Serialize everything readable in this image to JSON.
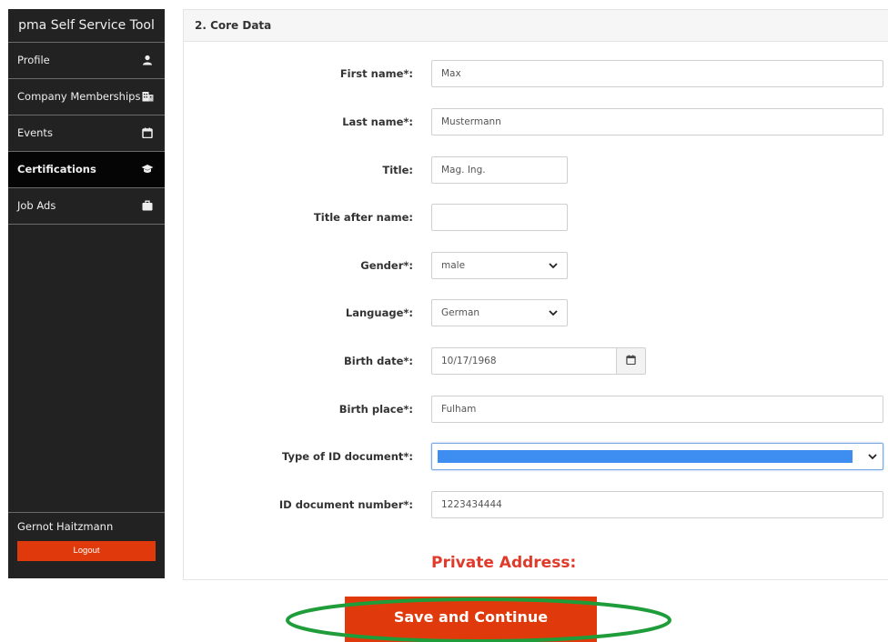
{
  "sidebar": {
    "title": "pma Self Service Tool",
    "items": [
      {
        "label": "Profile",
        "icon": "user-icon",
        "active": false
      },
      {
        "label": "Company Memberships",
        "icon": "building-icon",
        "active": false
      },
      {
        "label": "Events",
        "icon": "calendar-icon",
        "active": false
      },
      {
        "label": "Certifications",
        "icon": "graduation-cap-icon",
        "active": true
      },
      {
        "label": "Job Ads",
        "icon": "briefcase-icon",
        "active": false
      }
    ],
    "user_name": "Gernot Haitzmann",
    "logout_label": "Logout"
  },
  "panel": {
    "header": "2. Core Data",
    "fields": {
      "first_name": {
        "label": "First name*:",
        "value": "Max"
      },
      "last_name": {
        "label": "Last name*:",
        "value": "Mustermann"
      },
      "title": {
        "label": "Title:",
        "value": "Mag. Ing."
      },
      "title_after": {
        "label": "Title after name:",
        "value": ""
      },
      "gender": {
        "label": "Gender*:",
        "value": "male"
      },
      "language": {
        "label": "Language*:",
        "value": "German"
      },
      "birth_date": {
        "label": "Birth date*:",
        "value": "10/17/1968"
      },
      "birth_place": {
        "label": "Birth place*:",
        "value": "Fulham"
      },
      "id_type": {
        "label": "Type of ID document*:",
        "value": ""
      },
      "id_number": {
        "label": "ID document number*:",
        "value": "1223434444"
      }
    },
    "private_address_title": "Private Address:"
  },
  "actions": {
    "save_label": "Save and Continue"
  },
  "colors": {
    "accent": "#e03a0c",
    "sidebar_bg": "#222222",
    "highlight_ring": "#1f9d3a",
    "select_highlight": "#3d8ef0",
    "section_title": "#e03a2a"
  }
}
